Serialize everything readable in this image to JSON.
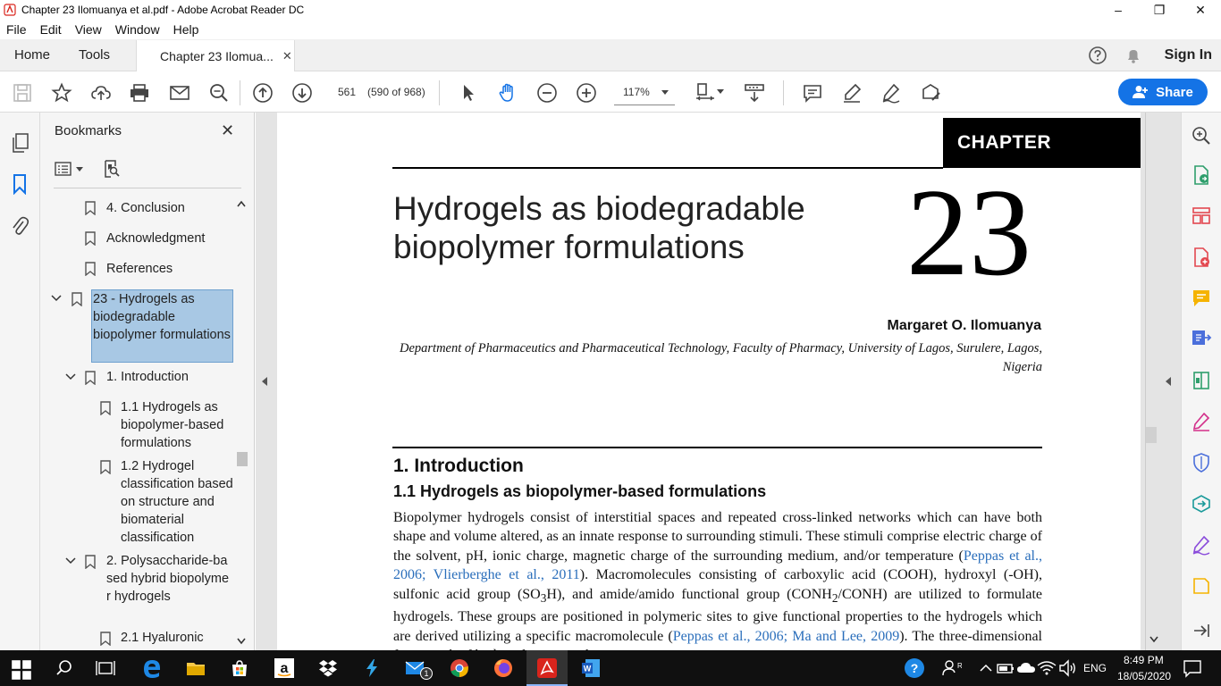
{
  "window": {
    "title": "Chapter 23 Ilomuanya et al.pdf - Adobe Acrobat Reader DC",
    "minimize": "–",
    "maximize": "❐",
    "close": "✕"
  },
  "menu": [
    "File",
    "Edit",
    "View",
    "Window",
    "Help"
  ],
  "tabs": {
    "home": "Home",
    "tools": "Tools",
    "doc": "Chapter 23 Ilomua...",
    "doc_close": "✕",
    "sign_in": "Sign In"
  },
  "toolbar": {
    "page_number": "561",
    "page_of": "(590 of 968)",
    "zoom": "117%",
    "share": "Share"
  },
  "bookmarks": {
    "header": "Bookmarks",
    "close": "✕",
    "items": [
      {
        "label": "4. Conclusion"
      },
      {
        "label": "Acknowledgment"
      },
      {
        "label": "References"
      },
      {
        "label": "23 - Hydrogels as biodegradable biopolymer formulations"
      },
      {
        "label": "1. Introduction"
      },
      {
        "label": "1.1 Hydrogels as biopolymer-based formulations"
      },
      {
        "label": "1.2 Hydrogel classification based on structure and biomaterial classification"
      },
      {
        "label": "2. Polysaccharide-based hybrid biopolymer hydrogels"
      },
      {
        "label": "2.1 Hyaluronic"
      }
    ]
  },
  "page": {
    "chapter_label": "CHAPTER",
    "chapter_number": "23",
    "title": "Hydrogels as biodegradable biopolymer formulations",
    "author": "Margaret O. Ilomuanya",
    "affiliation": "Department of Pharmaceutics and Pharmaceutical Technology, Faculty of Pharmacy, University of Lagos, Surulere, Lagos, Nigeria",
    "h1": "1.  Introduction",
    "h2": "1.1  Hydrogels as biopolymer-based formulations",
    "body_1": "Biopolymer hydrogels consist of interstitial spaces and repeated cross-linked networks which can have both shape and volume altered, as an innate response to surrounding stimuli. These stimuli comprise electric charge of the solvent, pH, ionic charge, magnetic charge of the surrounding medium, and/or temperature (",
    "cite_1": "Peppas et al., 2006; Vlierberghe et al., 2011",
    "body_2": "). Macromolecules consisting of carboxylic acid (COOH), hydroxyl (-OH), sulfonic acid group (SO",
    "sub_3": "3",
    "body_3": "H), and amide/amido functional group (CONH",
    "sub_2": "2",
    "body_4": "/CONH) are utilized to formulate hydrogels. These groups are positioned in polymeric sites to give functional properties to the hydrogels which are derived utilizing a specific macromolecule (",
    "cite_2": "Peppas et al., 2006; Ma and Lee, 2009",
    "body_5": "). The three-dimensional framework of hydrogels ensures that"
  },
  "taskbar": {
    "mail_badge": "1",
    "language": "ENG",
    "time": "8:49 PM",
    "date": "18/05/2020"
  },
  "colors": {
    "accent": "#1473e6",
    "selection": "#a8c8e4",
    "citation": "#2a6ebb",
    "taskbar": "#101010"
  }
}
